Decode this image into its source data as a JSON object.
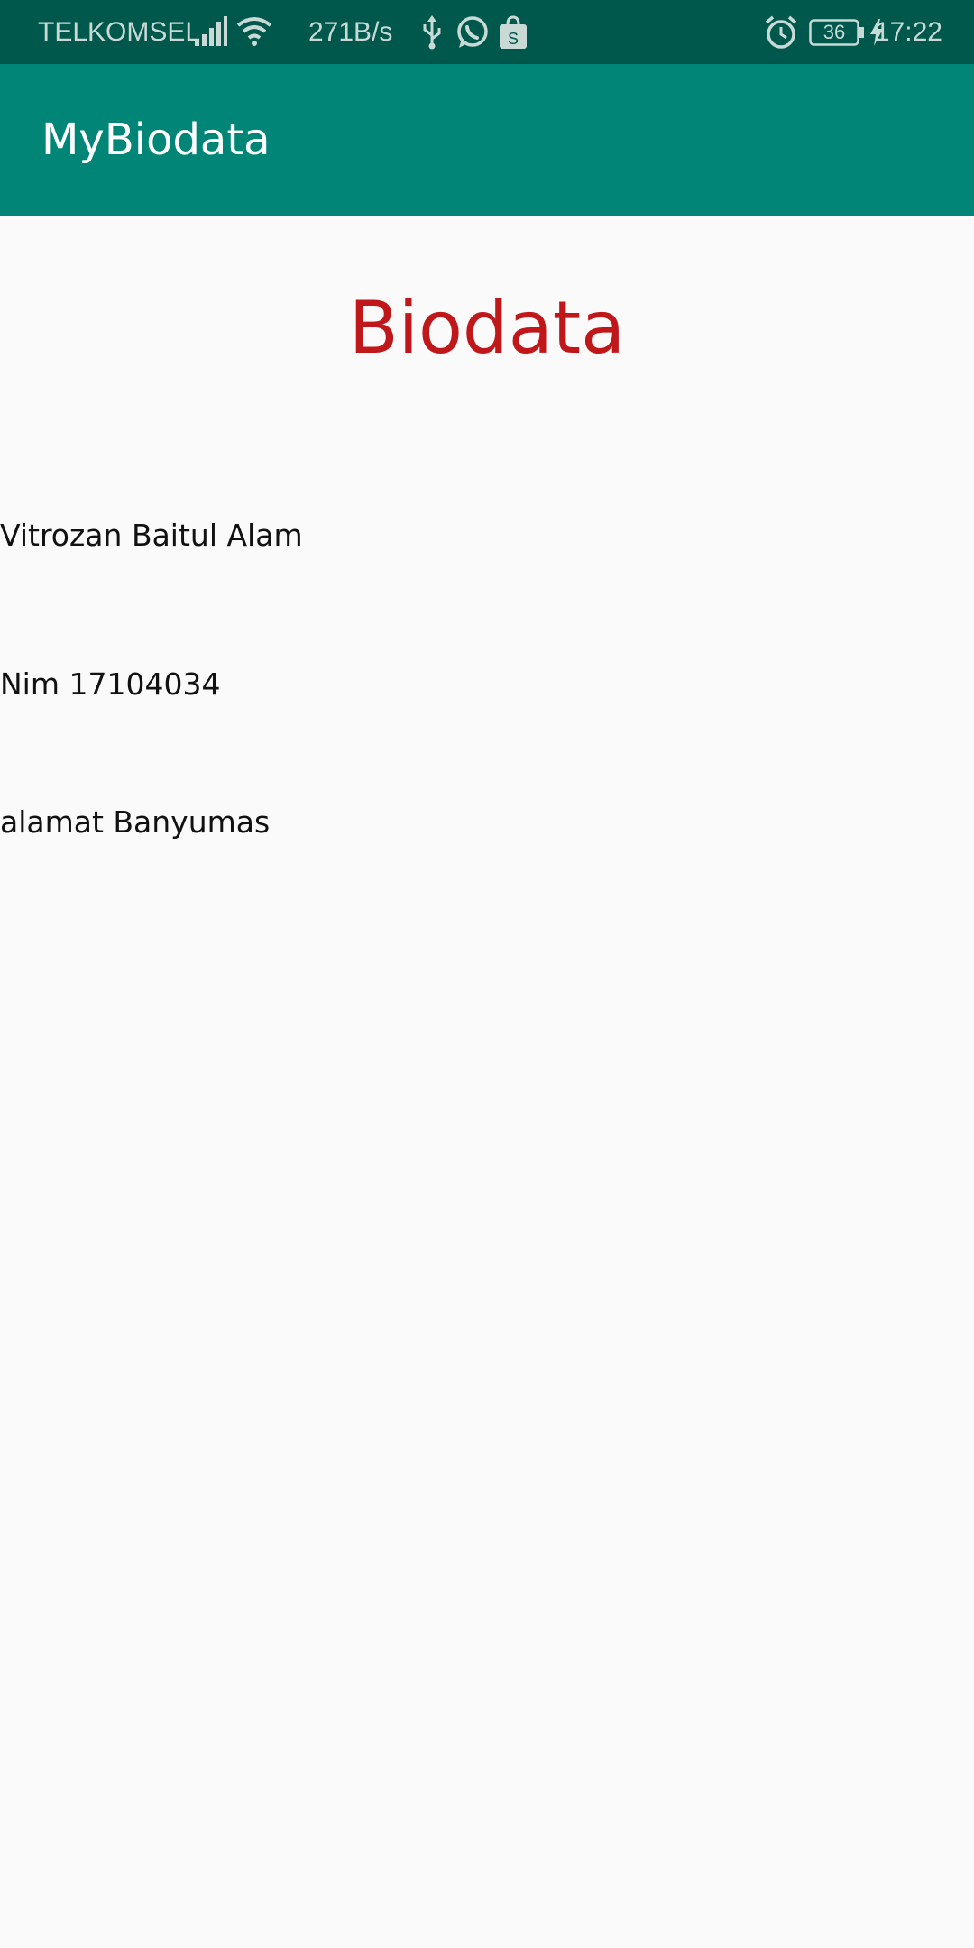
{
  "status_bar": {
    "carrier": "TELKOMSEL",
    "network_speed": "271B/s",
    "battery_level": "36",
    "time": "17:22",
    "icons": [
      "signal-icon",
      "wifi-icon",
      "usb-icon",
      "whatsapp-icon",
      "shopee-icon",
      "alarm-icon",
      "battery-icon",
      "charging-icon"
    ]
  },
  "app_bar": {
    "title": "MyBiodata",
    "color": "#008577"
  },
  "main": {
    "heading": "Biodata",
    "heading_color": "#c0171b",
    "fields": {
      "name": "Vitrozan Baitul Alam",
      "nim": "Nim 17104034",
      "alamat": "alamat Banyumas"
    }
  }
}
